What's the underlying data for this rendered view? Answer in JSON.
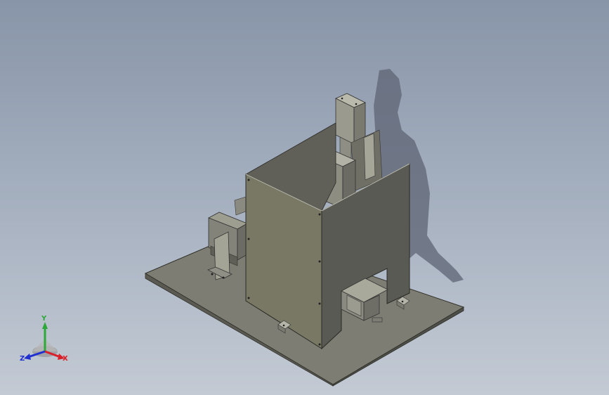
{
  "viewport": {
    "background_top": "#8895a8",
    "background_bottom": "#c3cad4"
  },
  "model": {
    "base_color": "#7b7b70",
    "enclosure_color": "#6f7062",
    "shadow_color": "#5a6070"
  },
  "triad": {
    "x_label": "X",
    "y_label": "Y",
    "z_label": "Z",
    "x_color": "#d8202a",
    "y_color": "#2fa83a",
    "z_color": "#2030d0"
  }
}
